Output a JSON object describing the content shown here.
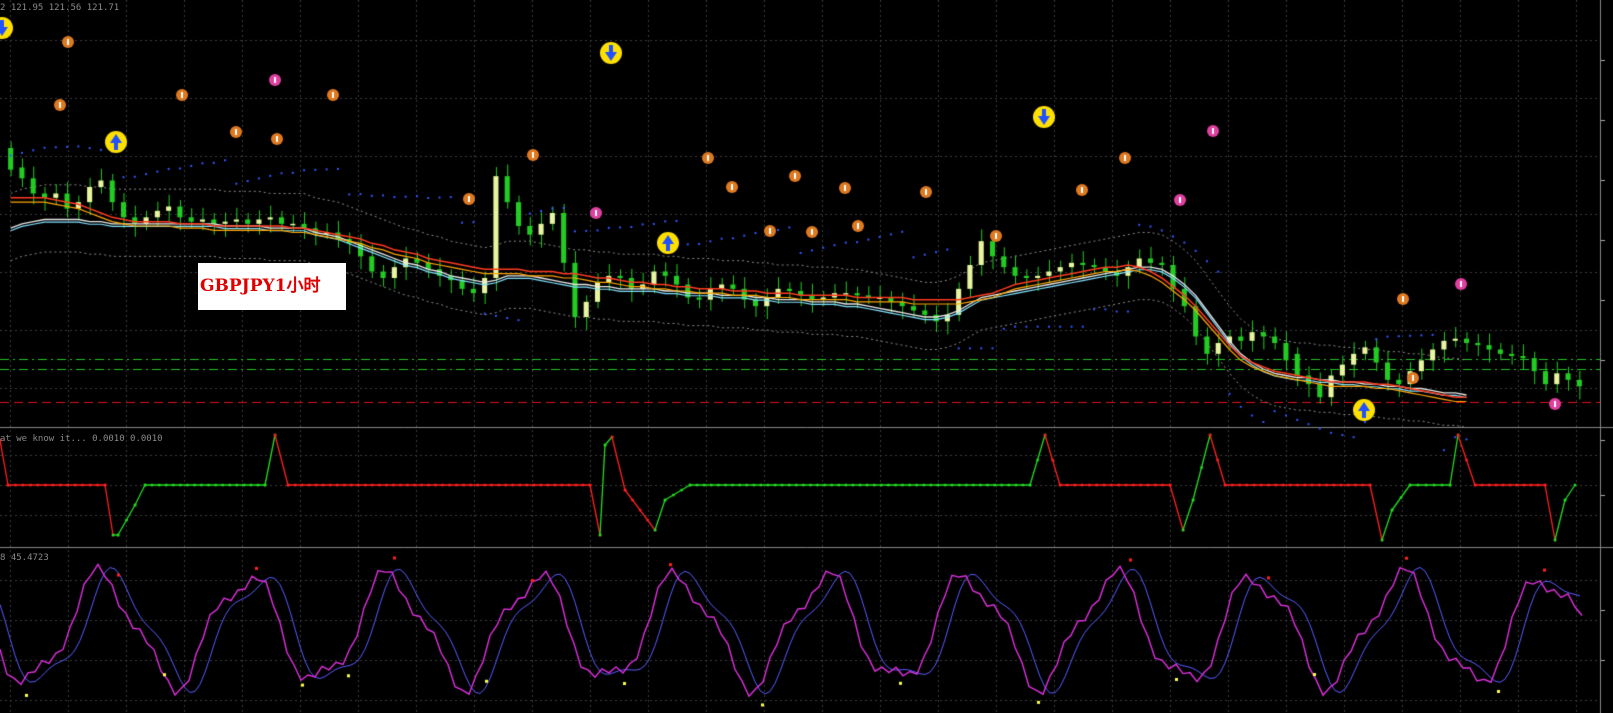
{
  "header": {
    "main_ohlc": "2 121.95 121.56 121.71",
    "indicator1": "at we know it... 0.0010 0.0010",
    "indicator2": "8 45.4723"
  },
  "label": {
    "text": "GBPJPY1小时"
  },
  "colors": {
    "background": "#000000",
    "grid": "#3a3a3a",
    "bull_candle": "#e8f5a0",
    "bear_candle": "#22cc22",
    "ma_red": "#ff3b1f",
    "ma_orange": "#ffa500",
    "ma_white": "#e8e8e8",
    "ma_cyan": "#7fe0ff",
    "psar": "#3355ff",
    "envelope": "#8a8a8a",
    "level_green": "#22c322",
    "level_red": "#e01010",
    "line_red": "#ff2020",
    "line_green": "#22dd22",
    "osc_magenta": "#e030e0",
    "osc_blue": "#5a5aff",
    "dot_red": "#ff2020",
    "dot_yellow": "#ffff40",
    "marker_orange": "#e07a20",
    "marker_pink": "#e040a0",
    "marker_yellow": "#ffe000",
    "marker_blue": "#2050ff"
  },
  "chart_data": {
    "type": "line",
    "main_pane_y": [
      120.75,
      122.55
    ],
    "candles": [
      [
        121.95,
        121.85
      ],
      [
        121.86,
        121.81
      ],
      [
        121.81,
        121.74
      ],
      [
        121.74,
        121.72
      ],
      [
        121.72,
        121.74
      ],
      [
        121.74,
        121.67
      ],
      [
        121.67,
        121.7
      ],
      [
        121.7,
        121.77
      ],
      [
        121.77,
        121.8
      ],
      [
        121.8,
        121.7
      ],
      [
        121.7,
        121.63
      ],
      [
        121.63,
        121.6
      ],
      [
        121.6,
        121.63
      ],
      [
        121.63,
        121.66
      ],
      [
        121.66,
        121.68
      ],
      [
        121.68,
        121.63
      ],
      [
        121.63,
        121.61
      ],
      [
        121.61,
        121.62
      ],
      [
        121.62,
        121.6
      ],
      [
        121.6,
        121.61
      ],
      [
        121.61,
        121.62
      ],
      [
        121.62,
        121.6
      ],
      [
        121.6,
        121.62
      ],
      [
        121.62,
        121.63
      ],
      [
        121.63,
        121.6
      ],
      [
        121.6,
        121.6
      ],
      [
        121.6,
        121.58
      ],
      [
        121.58,
        121.56
      ],
      [
        121.56,
        121.56
      ],
      [
        121.56,
        121.53
      ],
      [
        121.53,
        121.51
      ],
      [
        121.51,
        121.45
      ],
      [
        121.45,
        121.38
      ],
      [
        121.38,
        121.35
      ],
      [
        121.35,
        121.4
      ],
      [
        121.4,
        121.44
      ],
      [
        121.44,
        121.42
      ],
      [
        121.42,
        121.39
      ],
      [
        121.39,
        121.36
      ],
      [
        121.36,
        121.34
      ],
      [
        121.34,
        121.3
      ],
      [
        121.3,
        121.28
      ],
      [
        121.28,
        121.35
      ],
      [
        121.35,
        121.82
      ],
      [
        121.82,
        121.7
      ],
      [
        121.7,
        121.59
      ],
      [
        121.59,
        121.55
      ],
      [
        121.55,
        121.6
      ],
      [
        121.6,
        121.65
      ],
      [
        121.65,
        121.42
      ],
      [
        121.42,
        121.17
      ],
      [
        121.17,
        121.24
      ],
      [
        121.24,
        121.33
      ],
      [
        121.33,
        121.36
      ],
      [
        121.36,
        121.35
      ],
      [
        121.35,
        121.3
      ],
      [
        121.3,
        121.32
      ],
      [
        121.32,
        121.38
      ],
      [
        121.38,
        121.36
      ],
      [
        121.36,
        121.32
      ],
      [
        121.32,
        121.26
      ],
      [
        121.26,
        121.25
      ],
      [
        121.25,
        121.3
      ],
      [
        121.3,
        121.32
      ],
      [
        121.32,
        121.3
      ],
      [
        121.3,
        121.25
      ],
      [
        121.25,
        121.22
      ],
      [
        121.22,
        121.26
      ],
      [
        121.26,
        121.3
      ],
      [
        121.3,
        121.29
      ],
      [
        121.29,
        121.27
      ],
      [
        121.27,
        121.25
      ],
      [
        121.25,
        121.26
      ],
      [
        121.26,
        121.28
      ],
      [
        121.28,
        121.28
      ],
      [
        121.28,
        121.27
      ],
      [
        121.27,
        121.26
      ],
      [
        121.26,
        121.26
      ],
      [
        121.26,
        121.24
      ],
      [
        121.24,
        121.22
      ],
      [
        121.22,
        121.2
      ],
      [
        121.2,
        121.18
      ],
      [
        121.18,
        121.15
      ],
      [
        121.15,
        121.18
      ],
      [
        121.18,
        121.3
      ],
      [
        121.3,
        121.41
      ],
      [
        121.41,
        121.52
      ],
      [
        121.52,
        121.45
      ],
      [
        121.45,
        121.4
      ],
      [
        121.4,
        121.36
      ],
      [
        121.36,
        121.35
      ],
      [
        121.35,
        121.36
      ],
      [
        121.36,
        121.38
      ],
      [
        121.38,
        121.4
      ],
      [
        121.4,
        121.42
      ],
      [
        121.42,
        121.41
      ],
      [
        121.41,
        121.4
      ],
      [
        121.4,
        121.38
      ],
      [
        121.38,
        121.36
      ],
      [
        121.36,
        121.4
      ],
      [
        121.4,
        121.44
      ],
      [
        121.44,
        121.42
      ],
      [
        121.42,
        121.41
      ],
      [
        121.41,
        121.3
      ],
      [
        121.3,
        121.22
      ],
      [
        121.22,
        121.08
      ],
      [
        121.08,
        121.0
      ],
      [
        121.0,
        121.05
      ],
      [
        121.05,
        121.08
      ],
      [
        121.08,
        121.06
      ],
      [
        121.06,
        121.1
      ],
      [
        121.1,
        121.08
      ],
      [
        121.08,
        121.05
      ],
      [
        121.05,
        120.97
      ],
      [
        121.0,
        120.9
      ],
      [
        120.9,
        120.86
      ],
      [
        120.86,
        120.8
      ],
      [
        120.8,
        120.9
      ],
      [
        120.9,
        120.95
      ],
      [
        120.95,
        121.0
      ],
      [
        121.0,
        121.03
      ],
      [
        121.03,
        120.96
      ],
      [
        120.96,
        120.88
      ],
      [
        120.88,
        120.86
      ],
      [
        120.86,
        120.92
      ],
      [
        120.92,
        120.97
      ],
      [
        120.97,
        121.02
      ],
      [
        121.02,
        121.06
      ],
      [
        121.06,
        121.07
      ],
      [
        121.07,
        121.05
      ],
      [
        121.05,
        121.04
      ],
      [
        121.04,
        121.02
      ],
      [
        121.02,
        121.0
      ],
      [
        121.0,
        120.99
      ],
      [
        120.99,
        120.98
      ],
      [
        120.98,
        120.92
      ],
      [
        120.92,
        120.86
      ],
      [
        120.86,
        120.91
      ],
      [
        120.91,
        120.88
      ],
      [
        120.88,
        120.85
      ]
    ],
    "ma_red": [
      121.72,
      121.72,
      121.72,
      121.72,
      121.71,
      121.7,
      121.69,
      121.67,
      121.65,
      121.63,
      121.62,
      121.61,
      121.61,
      121.61,
      121.61,
      121.6,
      121.6,
      121.6,
      121.59,
      121.59,
      121.59,
      121.59,
      121.59,
      121.59,
      121.59,
      121.58,
      121.58,
      121.57,
      121.56,
      121.55,
      121.54,
      121.53,
      121.51,
      121.5,
      121.48,
      121.47,
      121.46,
      121.44,
      121.43,
      121.42,
      121.41,
      121.4,
      121.39,
      121.39,
      121.39,
      121.39,
      121.38,
      121.38,
      121.38,
      121.37,
      121.37,
      121.36,
      121.35,
      121.35,
      121.34,
      121.33,
      121.33,
      121.32,
      121.32,
      121.31,
      121.31,
      121.3,
      121.3,
      121.3,
      121.29,
      121.29,
      121.29,
      121.28,
      121.28,
      121.28,
      121.27,
      121.27,
      121.27,
      121.27,
      121.27,
      121.26,
      121.26,
      121.26,
      121.26,
      121.26,
      121.25,
      121.25,
      121.25,
      121.25,
      121.25,
      121.26,
      121.27,
      121.28,
      121.3,
      121.32,
      121.33,
      121.34,
      121.35,
      121.36,
      121.37,
      121.38,
      121.39,
      121.4,
      121.4,
      121.41,
      121.4,
      121.38,
      121.35,
      121.31,
      121.27,
      121.22,
      121.16,
      121.1,
      121.04,
      120.99,
      120.96,
      120.94,
      120.92,
      120.91,
      120.9,
      120.89,
      120.88,
      120.87,
      120.87,
      120.87,
      120.87,
      120.86,
      120.86,
      120.85,
      120.84,
      120.83,
      120.82,
      120.81,
      120.8,
      120.8
    ],
    "ma_white": [
      121.58,
      121.6,
      121.61,
      121.62,
      121.62,
      121.62,
      121.62,
      121.61,
      121.61,
      121.6,
      121.6,
      121.6,
      121.6,
      121.6,
      121.6,
      121.6,
      121.6,
      121.6,
      121.6,
      121.59,
      121.59,
      121.59,
      121.59,
      121.58,
      121.58,
      121.58,
      121.58,
      121.56,
      121.55,
      121.54,
      121.52,
      121.5,
      121.48,
      121.46,
      121.44,
      121.42,
      121.41,
      121.39,
      121.38,
      121.36,
      121.35,
      121.34,
      121.33,
      121.34,
      121.36,
      121.36,
      121.36,
      121.35,
      121.34,
      121.33,
      121.32,
      121.32,
      121.31,
      121.31,
      121.3,
      121.3,
      121.3,
      121.3,
      121.29,
      121.29,
      121.28,
      121.28,
      121.28,
      121.27,
      121.27,
      121.27,
      121.26,
      121.26,
      121.25,
      121.25,
      121.25,
      121.24,
      121.24,
      121.24,
      121.23,
      121.23,
      121.22,
      121.21,
      121.2,
      121.19,
      121.18,
      121.17,
      121.17,
      121.18,
      121.2,
      121.23,
      121.26,
      121.27,
      121.28,
      121.29,
      121.3,
      121.31,
      121.32,
      121.33,
      121.34,
      121.35,
      121.36,
      121.37,
      121.38,
      121.39,
      121.4,
      121.4,
      121.39,
      121.36,
      121.32,
      121.27,
      121.2,
      121.13,
      121.06,
      121.0,
      120.96,
      120.93,
      120.91,
      120.9,
      120.89,
      120.89,
      120.88,
      120.88,
      120.87,
      120.87,
      120.86,
      120.86,
      120.85,
      120.85,
      120.84,
      120.84,
      120.83,
      120.82,
      120.82,
      120.81
    ]
  }
}
